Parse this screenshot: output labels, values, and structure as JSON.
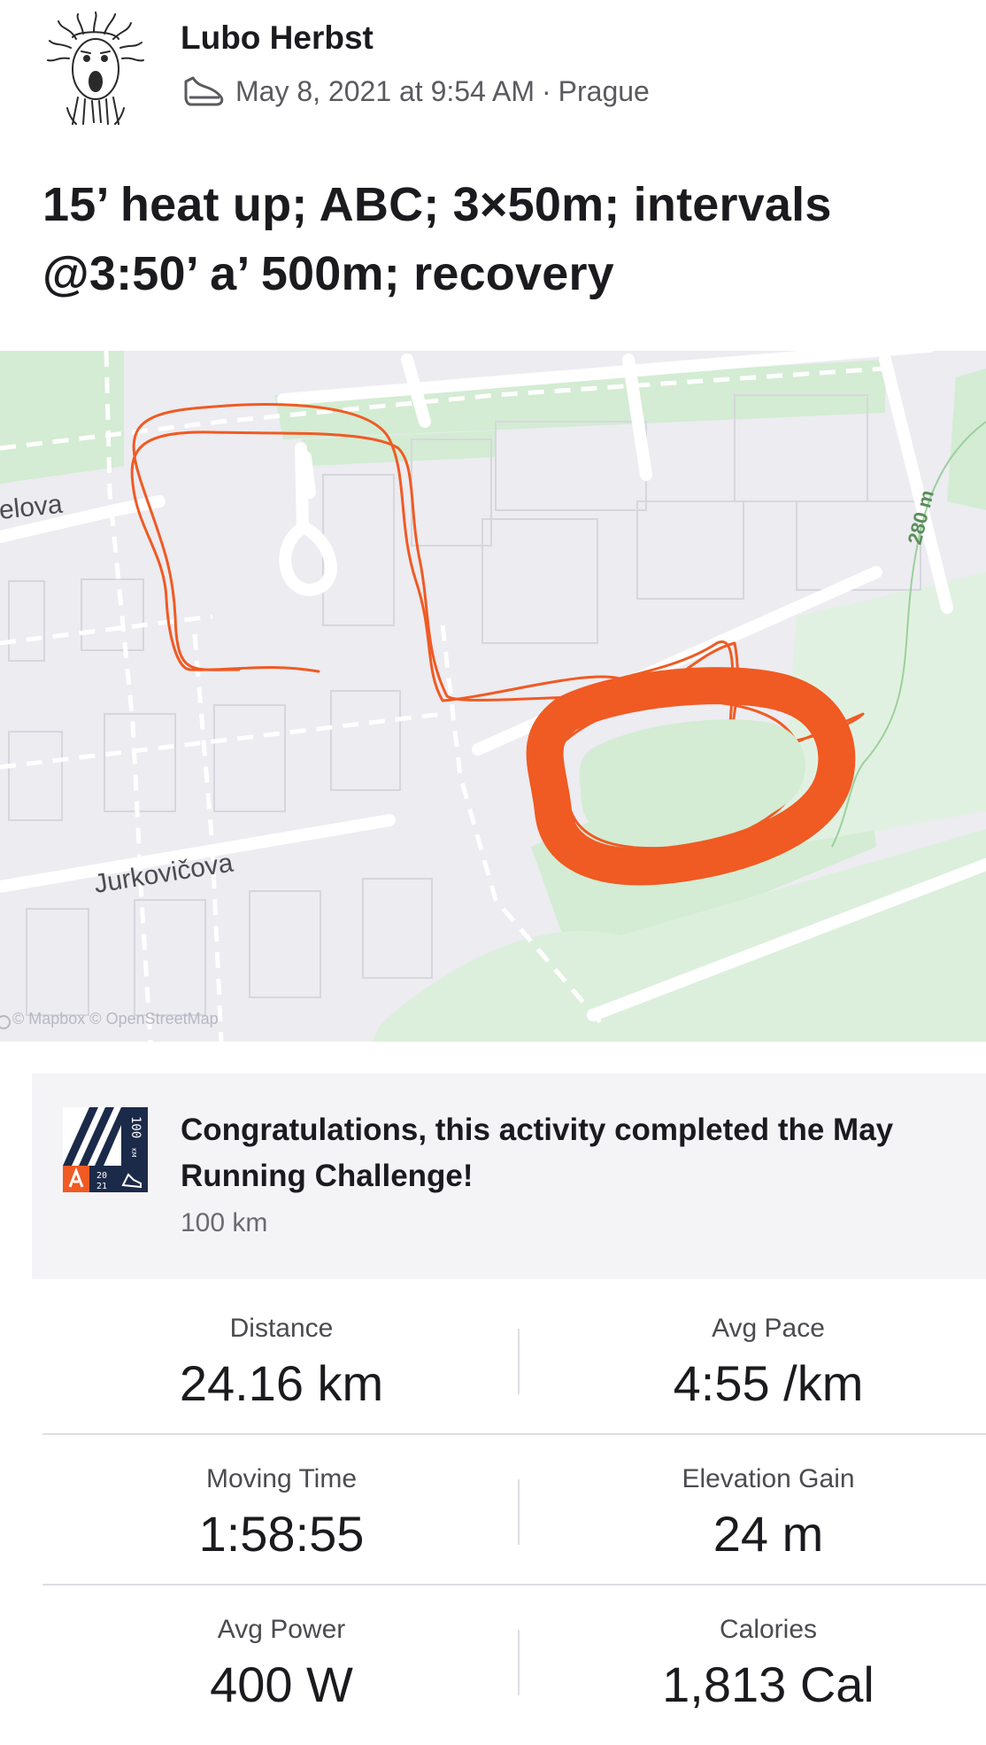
{
  "athlete": {
    "name": "Lubo Herbst",
    "date": "May 8, 2021 at 9:54 AM",
    "separator": "·",
    "location": "Prague",
    "sport_icon": "run-shoe-icon"
  },
  "activity": {
    "title": "15’ heat up; ABC; 3×50m; intervals @3:50’ a’ 500m; recovery"
  },
  "map": {
    "street_1": "elova",
    "street_2": "Jurkovičova",
    "contour_label": "280 m",
    "attribution": "© Mapbox © OpenStreetMap",
    "route_color": "#f05a23"
  },
  "challenge": {
    "text": "Congratulations, this activity completed the May Running Challenge!",
    "subtitle": "100 km",
    "badge_text": "100",
    "badge_unit": "KM",
    "badge_year_top": "20",
    "badge_year_bottom": "21"
  },
  "stats": {
    "distance_label": "Distance",
    "distance_value": "24.16 km",
    "pace_label": "Avg Pace",
    "pace_value": "4:55 /km",
    "moving_time_label": "Moving Time",
    "moving_time_value": "1:58:55",
    "elevation_label": "Elevation Gain",
    "elevation_value": "24 m",
    "power_label": "Avg Power",
    "power_value": "400 W",
    "calories_label": "Calories",
    "calories_value": "1,813 Cal"
  }
}
